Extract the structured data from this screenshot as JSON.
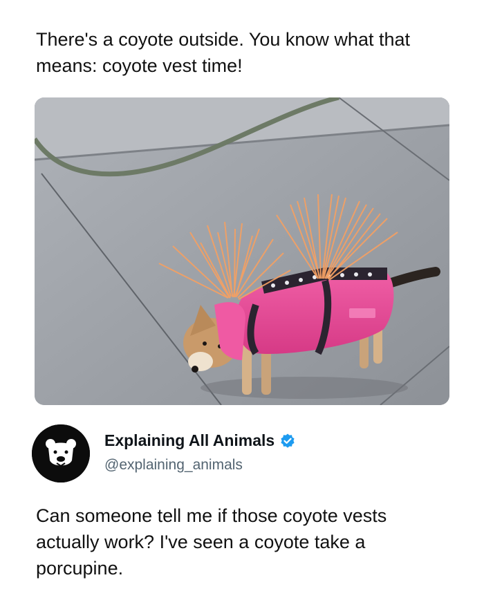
{
  "caption": "There's a coyote outside. You know what that means: coyote vest time!",
  "media": {
    "alt_icon": "dog-in-spiked-vest-photo"
  },
  "author": {
    "name": "Explaining All Animals",
    "handle": "@explaining_animals",
    "verified": true,
    "avatar_icon": "bear-logo-icon",
    "verified_color": "#1d9bf0"
  },
  "post": {
    "text": "Can someone tell me if those coyote vests actually work? I've seen a coyote take a porcupine."
  }
}
